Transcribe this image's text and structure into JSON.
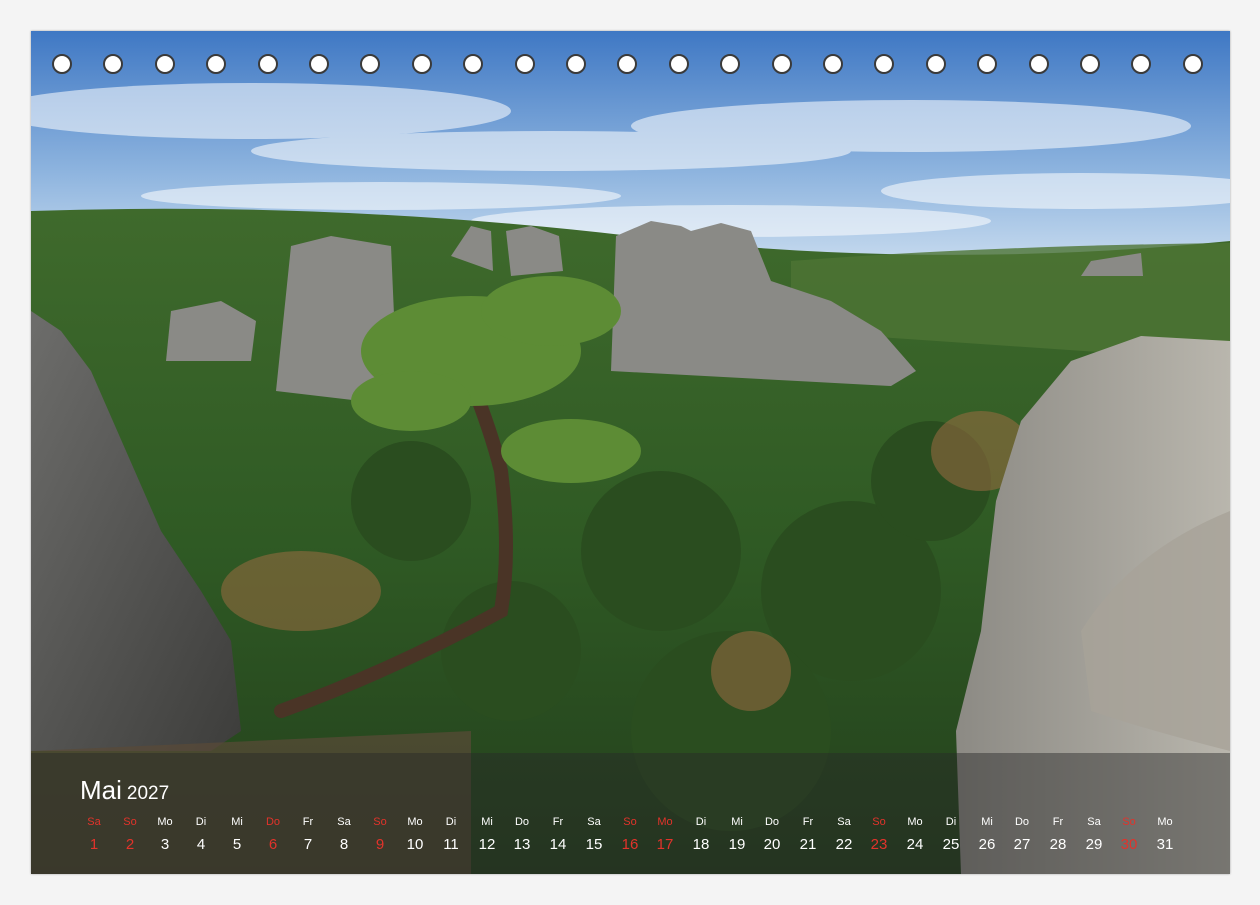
{
  "calendar": {
    "month": "Mai",
    "year": "2027",
    "holes": 23,
    "weekend_color": "#e2332b",
    "days": [
      {
        "dn": "Sa",
        "dd": "1",
        "red": true
      },
      {
        "dn": "So",
        "dd": "2",
        "red": true
      },
      {
        "dn": "Mo",
        "dd": "3",
        "red": false
      },
      {
        "dn": "Di",
        "dd": "4",
        "red": false
      },
      {
        "dn": "Mi",
        "dd": "5",
        "red": false
      },
      {
        "dn": "Do",
        "dd": "6",
        "red": true
      },
      {
        "dn": "Fr",
        "dd": "7",
        "red": false
      },
      {
        "dn": "Sa",
        "dd": "8",
        "red": false
      },
      {
        "dn": "So",
        "dd": "9",
        "red": true
      },
      {
        "dn": "Mo",
        "dd": "10",
        "red": false
      },
      {
        "dn": "Di",
        "dd": "11",
        "red": false
      },
      {
        "dn": "Mi",
        "dd": "12",
        "red": false
      },
      {
        "dn": "Do",
        "dd": "13",
        "red": false
      },
      {
        "dn": "Fr",
        "dd": "14",
        "red": false
      },
      {
        "dn": "Sa",
        "dd": "15",
        "red": false
      },
      {
        "dn": "So",
        "dd": "16",
        "red": true
      },
      {
        "dn": "Mo",
        "dd": "17",
        "red": true
      },
      {
        "dn": "Di",
        "dd": "18",
        "red": false
      },
      {
        "dn": "Mi",
        "dd": "19",
        "red": false
      },
      {
        "dn": "Do",
        "dd": "20",
        "red": false
      },
      {
        "dn": "Fr",
        "dd": "21",
        "red": false
      },
      {
        "dn": "Sa",
        "dd": "22",
        "red": false
      },
      {
        "dn": "So",
        "dd": "23",
        "red": true
      },
      {
        "dn": "Mo",
        "dd": "24",
        "red": false
      },
      {
        "dn": "Di",
        "dd": "25",
        "red": false
      },
      {
        "dn": "Mi",
        "dd": "26",
        "red": false
      },
      {
        "dn": "Do",
        "dd": "27",
        "red": false
      },
      {
        "dn": "Fr",
        "dd": "28",
        "red": false
      },
      {
        "dn": "Sa",
        "dd": "29",
        "red": false
      },
      {
        "dn": "So",
        "dd": "30",
        "red": true
      },
      {
        "dn": "Mo",
        "dd": "31",
        "red": false
      }
    ]
  }
}
